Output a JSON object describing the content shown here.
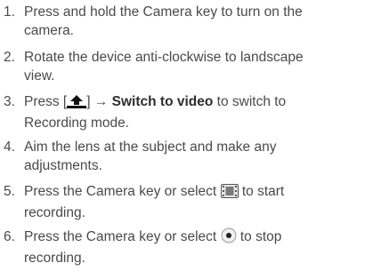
{
  "steps": [
    {
      "number": "1.",
      "line1": "Press and hold the Camera key to turn on the",
      "line2": "camera."
    },
    {
      "number": "2.",
      "line1": "Rotate the device anti-clockwise to landscape",
      "line2": "view."
    },
    {
      "number": "3.",
      "pre": "Press [",
      "post": "] → ",
      "bold": "Switch to video",
      "after": " to switch to",
      "line2": "Recording mode.",
      "icon": "upload-arrow-icon"
    },
    {
      "number": "4.",
      "line1": "Aim the lens at the subject and make any",
      "line2": "adjustments."
    },
    {
      "number": "5.",
      "pre": "Press the Camera key or select ",
      "after": " to start",
      "line2": "recording.",
      "icon": "film-record-icon"
    },
    {
      "number": "6.",
      "pre": "Press the Camera key or select ",
      "after": " to stop",
      "line2": "recording.",
      "icon": "stop-dot-icon"
    }
  ]
}
